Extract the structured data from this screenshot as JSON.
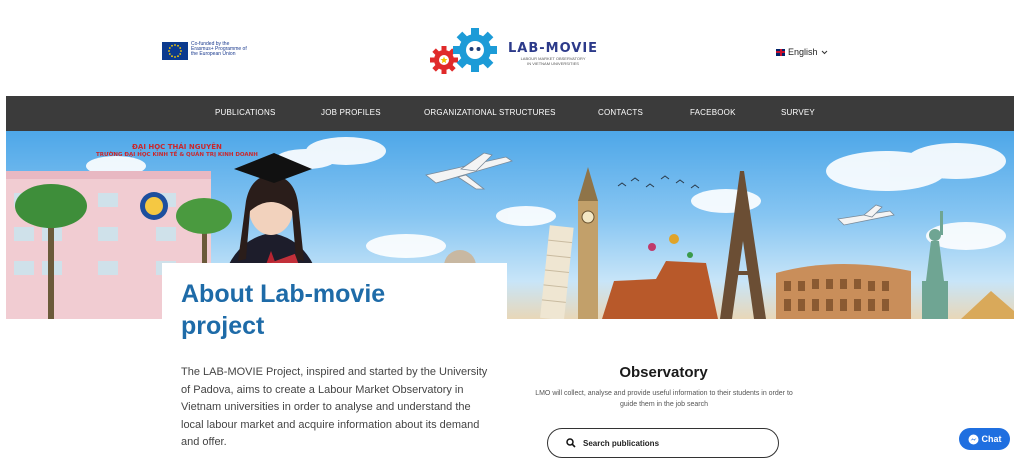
{
  "header": {
    "eu_text": "Co-funded by the Erasmus+ Programme of the European Union",
    "logo_title": "LAB-MOVIE",
    "logo_subtitle_line1": "LABOUR MARKET OBSERVATORY",
    "logo_subtitle_line2": "IN VIETNAM UNIVERSITIES",
    "language": "English"
  },
  "nav": {
    "items": [
      "PUBLICATIONS",
      "JOB PROFILES",
      "ORGANIZATIONAL STRUCTURES",
      "CONTACTS",
      "FACEBOOK",
      "SURVEY"
    ]
  },
  "hero": {
    "sign_line1": "ĐẠI HỌC THÁI NGUYÊN",
    "sign_line2": "TRƯỜNG ĐẠI HỌC KINH TẾ & QUẢN TRỊ KINH DOANH"
  },
  "about": {
    "title_line1": "About Lab-movie",
    "title_line2": "project",
    "body": "The LAB-MOVIE Project, inspired and started by the University of Padova, aims to create a Labour Market Observatory in Vietnam universities in order to analyse and understand the local labour market and acquire information about its demand and offer."
  },
  "observatory": {
    "title": "Observatory",
    "description": "LMO will collect, analyse and provide useful information to their students in order to guide them in the job search",
    "search_label": "Search publications"
  },
  "chat": {
    "label": "Chat"
  },
  "colors": {
    "nav_bg": "#3b3b3b",
    "title_blue": "#1e6ba8",
    "chat_blue": "#1f6fe0"
  }
}
